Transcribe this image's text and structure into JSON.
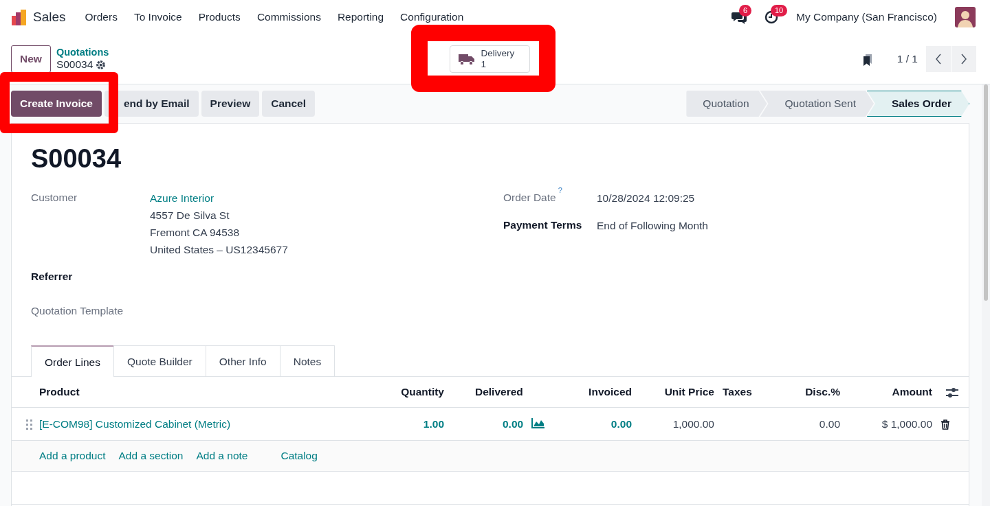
{
  "app": {
    "name": "Sales"
  },
  "menu": [
    "Orders",
    "To Invoice",
    "Products",
    "Commissions",
    "Reporting",
    "Configuration"
  ],
  "systray": {
    "messages_count": "6",
    "activities_count": "10",
    "company": "My Company (San Francisco)"
  },
  "control_panel": {
    "new_button": "New",
    "breadcrumb": {
      "parent": "Quotations",
      "current": "S00034"
    },
    "pager": "1 / 1"
  },
  "smart_buttons": [
    {
      "label": "Delivery",
      "count": "1",
      "highlighted": true
    }
  ],
  "actions": [
    {
      "label": "Create Invoice",
      "kind": "primary",
      "highlighted": true
    },
    {
      "label": "end by Email",
      "kind": "secondary",
      "highlighted": false
    },
    {
      "label": "Preview",
      "kind": "secondary",
      "highlighted": false
    },
    {
      "label": "Cancel",
      "kind": "secondary",
      "highlighted": false
    }
  ],
  "statusbar": [
    {
      "label": "Quotation",
      "selected": false
    },
    {
      "label": "Quotation Sent",
      "selected": false
    },
    {
      "label": "Sales Order",
      "selected": true
    }
  ],
  "record": {
    "name": "S00034",
    "left_fields": [
      {
        "label": "Customer",
        "strong": false,
        "link": "Azure Interior",
        "lines": [
          "4557 De Silva St",
          "Fremont CA 94538",
          "United States – US12345677"
        ]
      },
      {
        "label": "Referrer",
        "strong": true
      },
      {
        "label": "Quotation Template",
        "strong": false
      }
    ],
    "right_fields": [
      {
        "label": "Order Date",
        "strong": false,
        "help": "?",
        "value": "10/28/2024 12:09:25"
      },
      {
        "label": "Payment Terms",
        "strong": true,
        "value": "End of Following Month"
      }
    ]
  },
  "tabs": [
    {
      "label": "Order Lines",
      "selected": true
    },
    {
      "label": "Quote Builder",
      "selected": false
    },
    {
      "label": "Other Info",
      "selected": false
    },
    {
      "label": "Notes",
      "selected": false
    }
  ],
  "table": {
    "columns": [
      "Product",
      "Quantity",
      "Delivered",
      "Invoiced",
      "Unit Price",
      "Taxes",
      "Disc.%",
      "Amount"
    ],
    "rows": [
      {
        "product": "[E-COM98] Customized Cabinet (Metric)",
        "quantity": "1.00",
        "delivered": "0.00",
        "invoiced": "0.00",
        "unit_price": "1,000.00",
        "discount": "0.00",
        "amount": "$ 1,000.00"
      }
    ],
    "add_links": [
      "Add a product",
      "Add a section",
      "Add a note",
      "Catalog"
    ]
  }
}
